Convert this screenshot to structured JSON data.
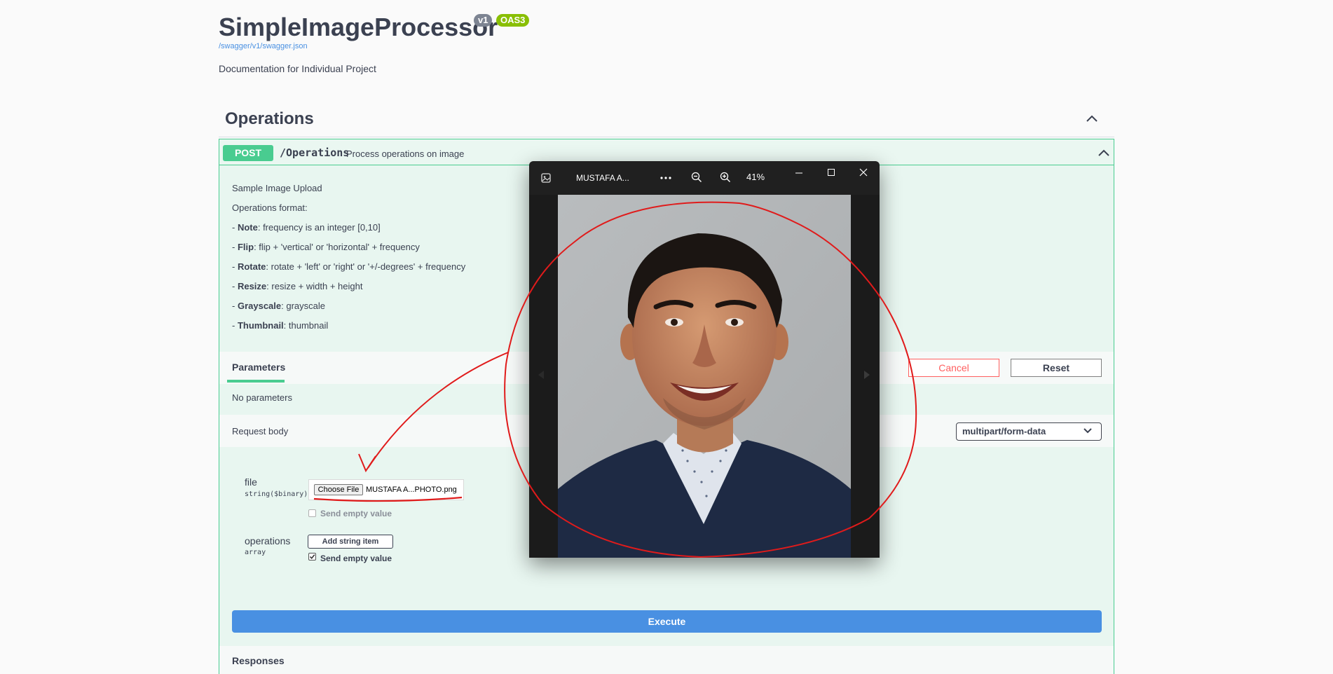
{
  "header": {
    "title": "SimpleImageProcessor",
    "version_badge": "v1",
    "oas_badge": "OAS3",
    "spec_link": "/swagger/v1/swagger.json",
    "description": "Documentation for Individual Project"
  },
  "tag": {
    "name": "Operations"
  },
  "operation": {
    "method": "POST",
    "path": "/Operations",
    "summary": "Process operations on image",
    "description_lines": [
      {
        "bold": "",
        "text": "Sample Image Upload"
      },
      {
        "bold": "",
        "text": "Operations format:"
      },
      {
        "prefix": "- ",
        "bold": "Note",
        "text": ": frequency is an integer [0,10]"
      },
      {
        "prefix": "- ",
        "bold": "Flip",
        "text": ": flip + 'vertical' or 'horizontal' + frequency"
      },
      {
        "prefix": "- ",
        "bold": "Rotate",
        "text": ": rotate + 'left' or 'right' or '+/-degrees' + frequency"
      },
      {
        "prefix": "- ",
        "bold": "Resize",
        "text": ": resize + width + height"
      },
      {
        "prefix": "- ",
        "bold": "Grayscale",
        "text": ": grayscale"
      },
      {
        "prefix": "- ",
        "bold": "Thumbnail",
        "text": ": thumbnail"
      }
    ],
    "parameters_tab": "Parameters",
    "cancel_label": "Cancel",
    "reset_label": "Reset",
    "no_parameters": "No parameters",
    "request_body_label": "Request body",
    "content_type": "multipart/form-data",
    "fields": {
      "file": {
        "name": "file",
        "type": "string($binary)",
        "choose_label": "Choose File",
        "selected_file": "MUSTAFA A...PHOTO.png",
        "send_empty_label": "Send empty value",
        "send_empty_checked": false
      },
      "operations": {
        "name": "operations",
        "type": "array",
        "add_item_label": "Add string item",
        "send_empty_label": "Send empty value",
        "send_empty_checked": true
      }
    },
    "execute_label": "Execute",
    "responses_label": "Responses"
  },
  "viewer": {
    "title": "MUSTAFA A...",
    "zoom": "41%",
    "more_label": "...",
    "icons": [
      "gallery-icon",
      "more-icon",
      "zoom-out-icon",
      "zoom-in-icon",
      "minimize-icon",
      "maximize-icon",
      "close-icon"
    ]
  },
  "colors": {
    "post_green": "#49cc90",
    "execute_blue": "#4990e2",
    "cancel_red": "#ff6060",
    "annotation_red": "#e01b1b",
    "viewer_bg": "#202020"
  }
}
